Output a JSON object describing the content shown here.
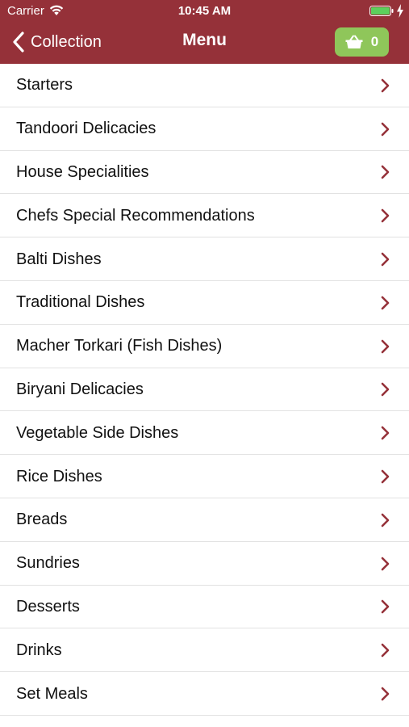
{
  "status_bar": {
    "carrier": "Carrier",
    "time": "10:45 AM",
    "wifi_icon": "wifi-icon",
    "battery_icon": "battery-full-icon"
  },
  "nav": {
    "back_label": "Collection",
    "title": "Menu",
    "cart_count": "0",
    "cart_icon": "basket-icon",
    "back_icon": "chevron-left-icon"
  },
  "colors": {
    "header_bg": "#953139",
    "cart_bg": "#8fc65a",
    "chevron": "#953139"
  },
  "menu": {
    "items": [
      {
        "label": "Starters"
      },
      {
        "label": "Tandoori Delicacies"
      },
      {
        "label": "House Specialities"
      },
      {
        "label": "Chefs Special Recommendations"
      },
      {
        "label": "Balti Dishes"
      },
      {
        "label": "Traditional Dishes"
      },
      {
        "label": "Macher Torkari (Fish Dishes)"
      },
      {
        "label": "Biryani Delicacies"
      },
      {
        "label": "Vegetable Side Dishes"
      },
      {
        "label": "Rice Dishes"
      },
      {
        "label": "Breads"
      },
      {
        "label": "Sundries"
      },
      {
        "label": "Desserts"
      },
      {
        "label": "Drinks"
      },
      {
        "label": "Set Meals"
      }
    ]
  }
}
